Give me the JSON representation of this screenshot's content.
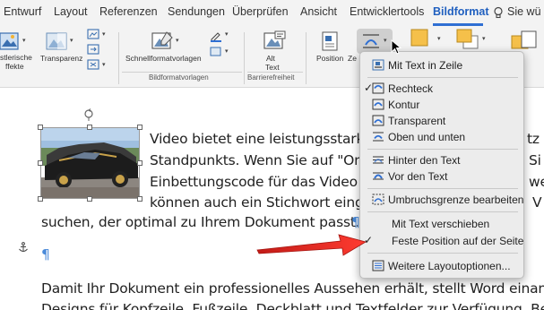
{
  "tabs": [
    {
      "label": "Entwurf"
    },
    {
      "label": "Layout"
    },
    {
      "label": "Referenzen"
    },
    {
      "label": "Sendungen"
    },
    {
      "label": "Überprüfen"
    },
    {
      "label": "Ansicht"
    },
    {
      "label": "Entwicklertools"
    },
    {
      "label": "Bildformat"
    },
    {
      "label": "Sie wü"
    }
  ],
  "ribbon": {
    "artistic_line1": "stlerische",
    "artistic_line2": "ffekte",
    "transparency": "Transparenz",
    "styles": "Schnellformatvorlagen",
    "styles_group": "Bildformatvorlagen",
    "alt_line1": "Alt",
    "alt_line2": "Text",
    "accessibility_group": "Barrierefreiheit",
    "position": "Position",
    "wrap_partial": "Ze"
  },
  "document": {
    "line1": "Video bietet eine leistungsstarke",
    "line1_tail": "tz",
    "line2": "Standpunkts. Wenn Sie auf \"Onl",
    "line2_tail": "Si",
    "line3": "Einbettungscode für das Video ei",
    "line3_tail": "we",
    "line4": "können auch ein Stichwort einge",
    "line4_tail": "V",
    "line5": "suchen, der optimal zu Ihrem Dokument passt.",
    "pilcrow": "¶",
    "line6": "Damit Ihr Dokument ein professionelles Aussehen erhält, stellt Word einand",
    "line7": "Designs für Kopfzeile, Fußzeile, Deckblatt und Textfelder zur Verfügung. Beis"
  },
  "menu": {
    "items": [
      {
        "label": "Mit Text in Zeile",
        "checked": false,
        "icon": "inline-text-icon"
      },
      {
        "label": "Rechteck",
        "checked": true,
        "icon": "square-wrap-icon"
      },
      {
        "label": "Kontur",
        "checked": false,
        "icon": "tight-wrap-icon"
      },
      {
        "label": "Transparent",
        "checked": false,
        "icon": "through-wrap-icon"
      },
      {
        "label": "Oben und unten",
        "checked": false,
        "icon": "top-bottom-wrap-icon"
      },
      {
        "label": "Hinter den Text",
        "checked": false,
        "icon": "behind-text-icon"
      },
      {
        "label": "Vor den Text",
        "checked": false,
        "icon": "in-front-text-icon"
      },
      {
        "label": "Umbruchsgrenze bearbeiten",
        "checked": false,
        "icon": "edit-wrap-points-icon"
      },
      {
        "label": "Mit Text verschieben",
        "checked": false,
        "icon": ""
      },
      {
        "label": "Feste Position auf der Seite",
        "checked": true,
        "icon": ""
      },
      {
        "label": "Weitere Layoutoptionen...",
        "checked": false,
        "icon": "layout-options-icon"
      }
    ],
    "checkmark": "✓"
  },
  "colors": {
    "accent": "#2f6fd3",
    "ribbon_bg": "#f3f3f3",
    "menu_bg": "#ececec",
    "arrow": "#e8231f",
    "pilcrow": "#4a8ad9"
  }
}
